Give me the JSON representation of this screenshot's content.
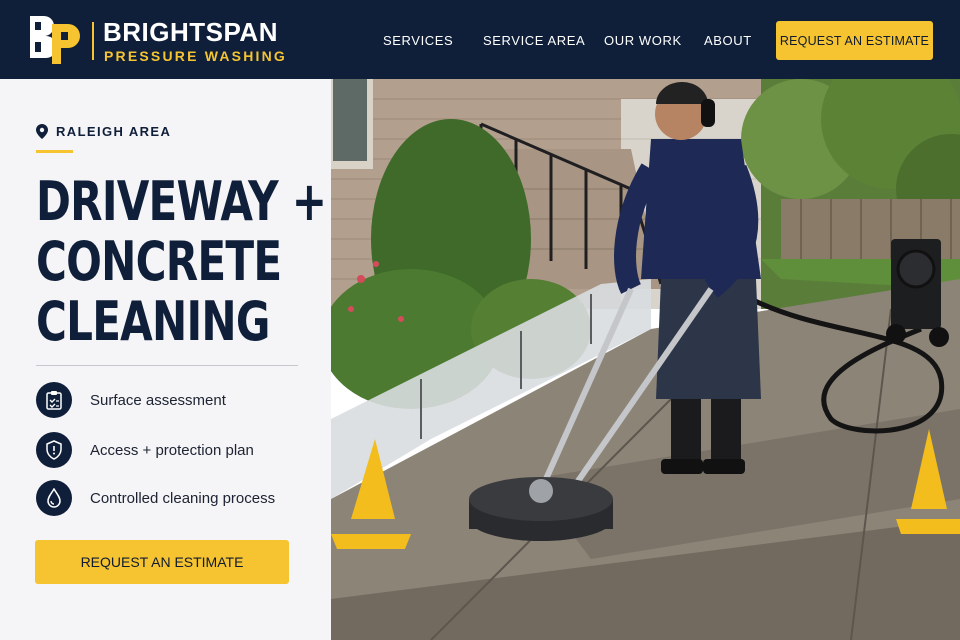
{
  "brand": {
    "name": "BRIGHTSPAN",
    "tagline": "PRESSURE WASHING",
    "accent": "#f5c430",
    "navy": "#0f1f3a"
  },
  "nav": {
    "items": [
      "SERVICES",
      "SERVICE AREA",
      "OUR WORK",
      "ABOUT"
    ],
    "cta_label": "REQUEST AN ESTIMATE"
  },
  "hero": {
    "location": "RALEIGH AREA",
    "headline": [
      "DRIVEWAY +",
      "CONCRETE",
      "CLEANING"
    ],
    "features": [
      {
        "icon": "clipboard-check-icon",
        "label": "Surface assessment"
      },
      {
        "icon": "shield-icon",
        "label": "Access + protection plan"
      },
      {
        "icon": "water-drop-icon",
        "label": "Controlled cleaning process"
      }
    ],
    "cta_label": "REQUEST AN ESTIMATE",
    "image_alt": "Technician cleaning a concrete driveway with a surface cleaner"
  }
}
